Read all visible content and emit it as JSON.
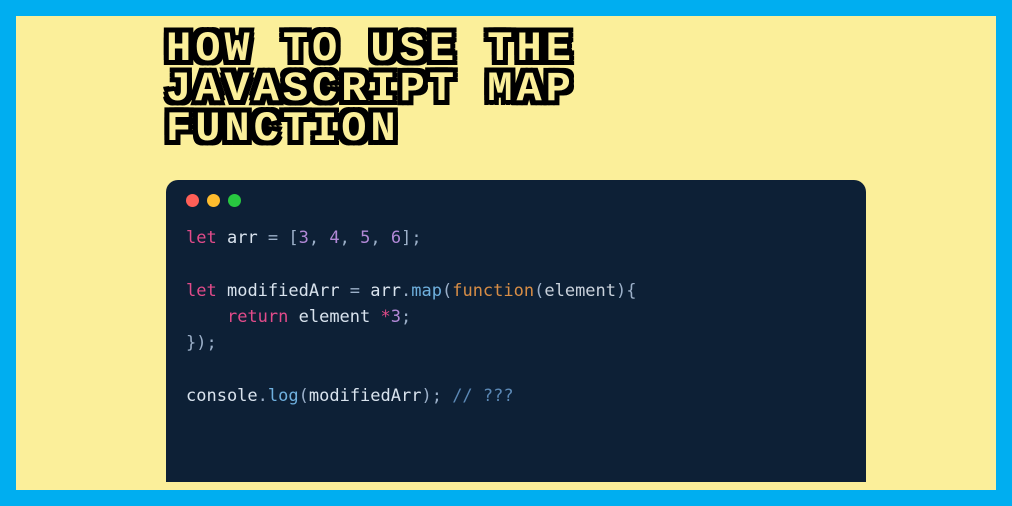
{
  "headline": {
    "line1": "HOW TO USE THE",
    "line2": "JAVASCRIPT MAP",
    "line3": "FUNCTION"
  },
  "window": {
    "traffic_red": "close",
    "traffic_yellow": "minimize",
    "traffic_green": "zoom"
  },
  "code": {
    "let1": "let",
    "arr_ident": "arr",
    "eq1": " = ",
    "lbrack": "[",
    "n1": "3",
    "c1": ", ",
    "n2": "4",
    "c2": ", ",
    "n3": "5",
    "c3": ", ",
    "n4": "6",
    "rbrack": "];",
    "let2": "let",
    "mod_ident": "modifiedArr",
    "eq2": " = ",
    "arr_ref": "arr",
    "dot": ".",
    "map_fn": "map",
    "lparen1": "(",
    "function_kw": "function",
    "lparen2": "(",
    "param": "element",
    "rparen2": ")",
    "lbrace": "{",
    "indent": "    ",
    "return_kw": "return",
    "elem_ref": " element ",
    "star": "*",
    "three": "3",
    "semi": ";",
    "rbrace_line": "});",
    "console": "console",
    "dot2": ".",
    "log": "log",
    "lparen3": "(",
    "mod_ref": "modifiedArr",
    "rparen3_semi": "); ",
    "comment": "// ???"
  }
}
